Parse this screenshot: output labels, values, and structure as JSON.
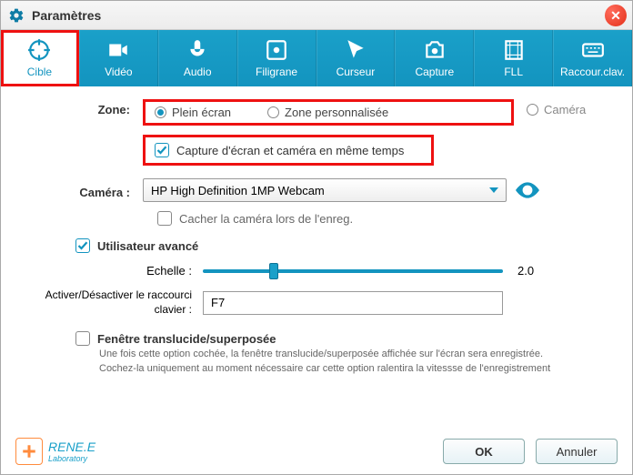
{
  "title": "Paramètres",
  "tabs": [
    {
      "id": "cible",
      "label": "Cible"
    },
    {
      "id": "video",
      "label": "Vidéo"
    },
    {
      "id": "audio",
      "label": "Audio"
    },
    {
      "id": "filigrane",
      "label": "Filigrane"
    },
    {
      "id": "curseur",
      "label": "Curseur"
    },
    {
      "id": "capture",
      "label": "Capture"
    },
    {
      "id": "fll",
      "label": "FLL"
    },
    {
      "id": "raccourci",
      "label": "Raccour.clav."
    }
  ],
  "zone": {
    "label": "Zone:",
    "full": "Plein écran",
    "custom": "Zone personnalisée",
    "camera": "Caméra"
  },
  "capture_both": "Capture d'écran et caméra en même temps",
  "camera_label": "Caméra :",
  "camera_value": "HP High Definition 1MP Webcam",
  "hide_cam": "Cacher la caméra lors de l'enreg.",
  "advanced_user": "Utilisateur avancé",
  "scale_label": "Echelle :",
  "scale_value": "2.0",
  "hotkey_label": "Activer/Désactiver le raccourci clavier :",
  "hotkey_value": "F7",
  "translucent": {
    "label": "Fenêtre translucide/superposée",
    "desc1": "Une fois cette option cochée, la fenêtre translucide/superposée affichée sur l'écran sera enregistrée.",
    "desc2": "Cochez-la uniquement au moment nécessaire car cette option ralentira la vitessse de l'enregistrement"
  },
  "logo": {
    "brand": "RENE.E",
    "sub": "Laboratory"
  },
  "buttons": {
    "ok": "OK",
    "cancel": "Annuler"
  }
}
